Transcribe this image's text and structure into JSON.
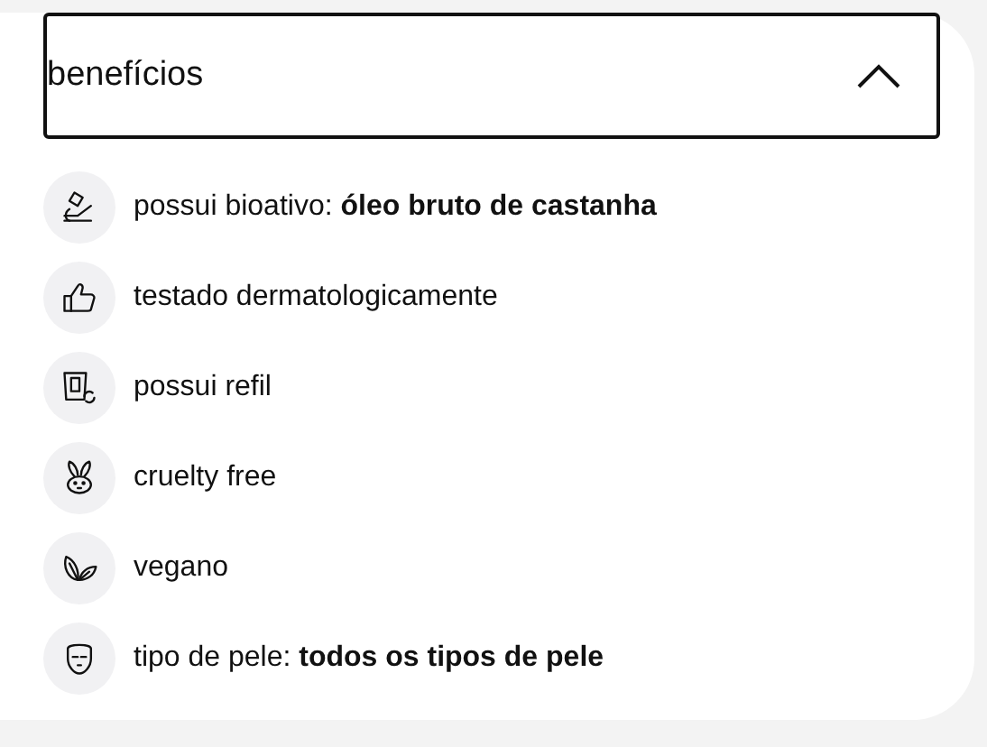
{
  "accordion": {
    "title": "benefícios",
    "expanded": true
  },
  "items": [
    {
      "text": "possui bioativo: **óleo bruto de castanha**"
    },
    {
      "text": "testado dermatologicamente"
    },
    {
      "text": "possui refil"
    },
    {
      "text": "cruelty free"
    },
    {
      "text": "vegano"
    },
    {
      "text": "tipo de pele: **todos os tipos de pele**"
    }
  ]
}
